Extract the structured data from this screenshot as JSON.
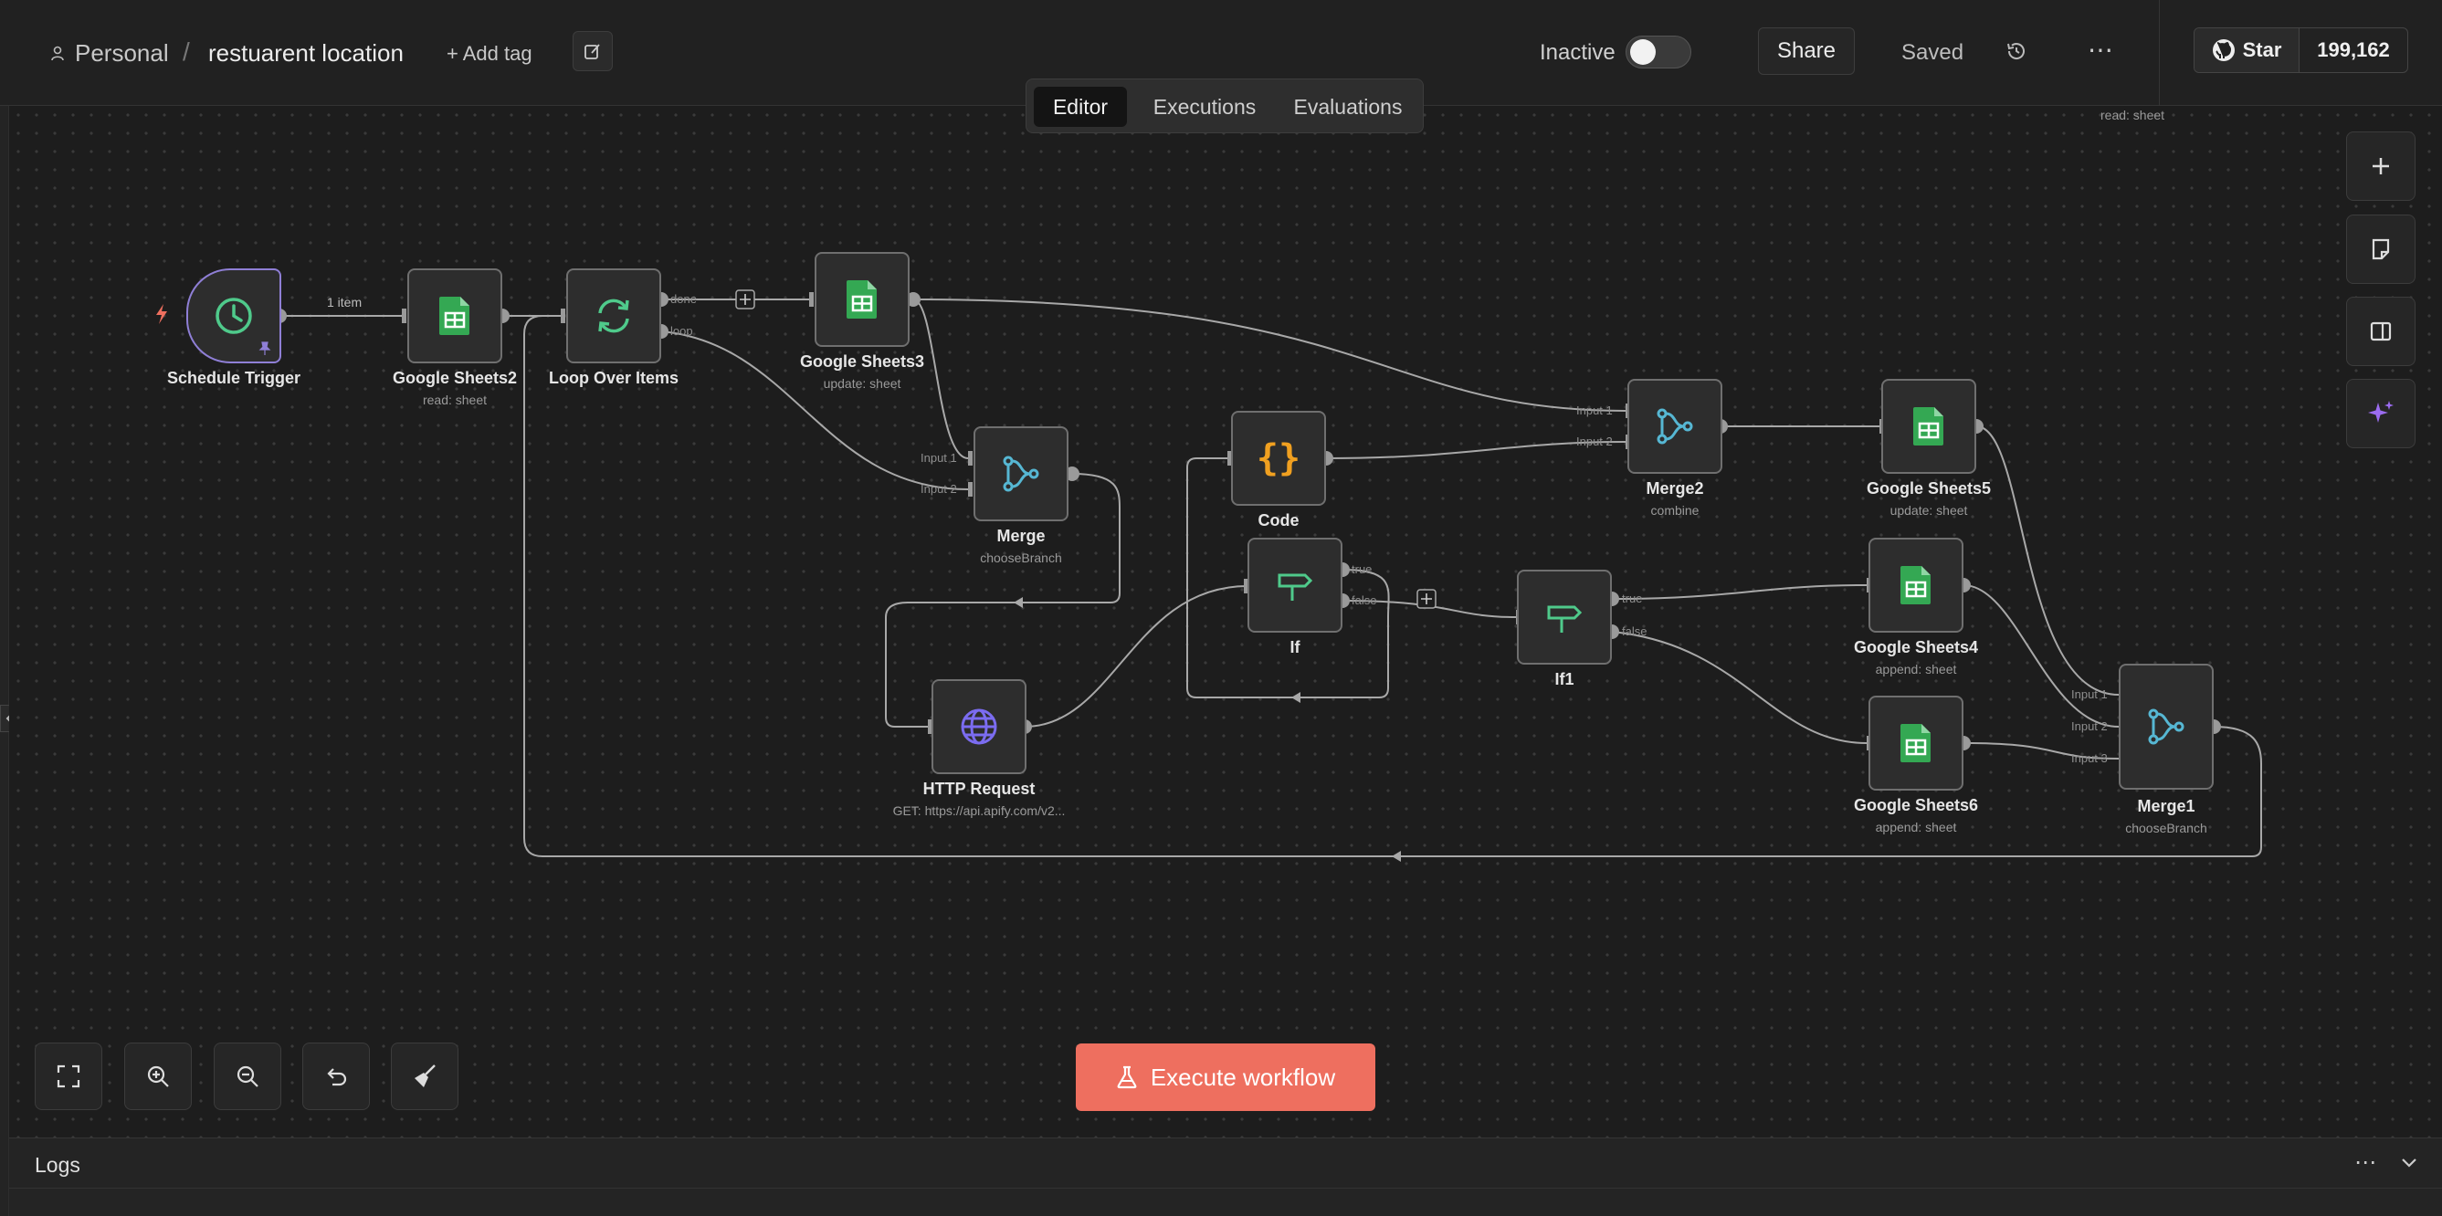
{
  "breadcrumb": {
    "owner": "Personal",
    "separator": "/",
    "workflow_name": "restuarent location",
    "add_tag": "+ Add tag"
  },
  "header": {
    "status_label": "Inactive",
    "share": "Share",
    "saved": "Saved",
    "more": "⋯",
    "github_star": "Star",
    "github_count": "199,162"
  },
  "tabs": [
    {
      "label": "Editor",
      "active": true
    },
    {
      "label": "Executions",
      "active": false
    },
    {
      "label": "Evaluations",
      "active": false
    }
  ],
  "nodes": [
    {
      "name": "Schedule Trigger",
      "subtitle": "",
      "icon": "clock-icon"
    },
    {
      "name": "Google Sheets2",
      "subtitle": "read: sheet",
      "icon": "google-sheets-icon"
    },
    {
      "name": "Loop Over Items",
      "subtitle": "",
      "icon": "loop-icon"
    },
    {
      "name": "Google Sheets3",
      "subtitle": "update: sheet",
      "icon": "google-sheets-icon"
    },
    {
      "name": "Merge",
      "subtitle": "chooseBranch",
      "icon": "merge-icon"
    },
    {
      "name": "Code",
      "subtitle": "",
      "icon": "code-icon"
    },
    {
      "name": "If",
      "subtitle": "",
      "icon": "if-icon"
    },
    {
      "name": "HTTP Request",
      "subtitle": "GET: https://api.apify.com/v2...",
      "icon": "globe-icon"
    },
    {
      "name": "If1",
      "subtitle": "",
      "icon": "if-icon"
    },
    {
      "name": "Merge2",
      "subtitle": "combine",
      "icon": "merge-icon"
    },
    {
      "name": "Google Sheets5",
      "subtitle": "update: sheet",
      "icon": "google-sheets-icon"
    },
    {
      "name": "Google Sheets4",
      "subtitle": "append: sheet",
      "icon": "google-sheets-icon"
    },
    {
      "name": "Google Sheets6",
      "subtitle": "append: sheet",
      "icon": "google-sheets-icon"
    },
    {
      "name": "Merge1",
      "subtitle": "chooseBranch",
      "icon": "merge-icon"
    }
  ],
  "edge_labels": {
    "item_count": "1 item",
    "done": "done",
    "loop": "loop",
    "true": "true",
    "false": "false",
    "input1": "Input 1",
    "input2": "Input 2",
    "input3": "Input 3"
  },
  "canvas_hint": "read: sheet",
  "execute_button": "Execute workflow",
  "logs": {
    "title": "Logs",
    "more": "⋯"
  },
  "colors": {
    "accent": "#ee6f5f",
    "sheets_green": "#34a853",
    "merge_blue": "#56b7d3",
    "if_green": "#4fca8b",
    "code_orange": "#f0a020",
    "http_purple": "#7b6cf0",
    "trigger_purple": "#8f7fd6"
  }
}
